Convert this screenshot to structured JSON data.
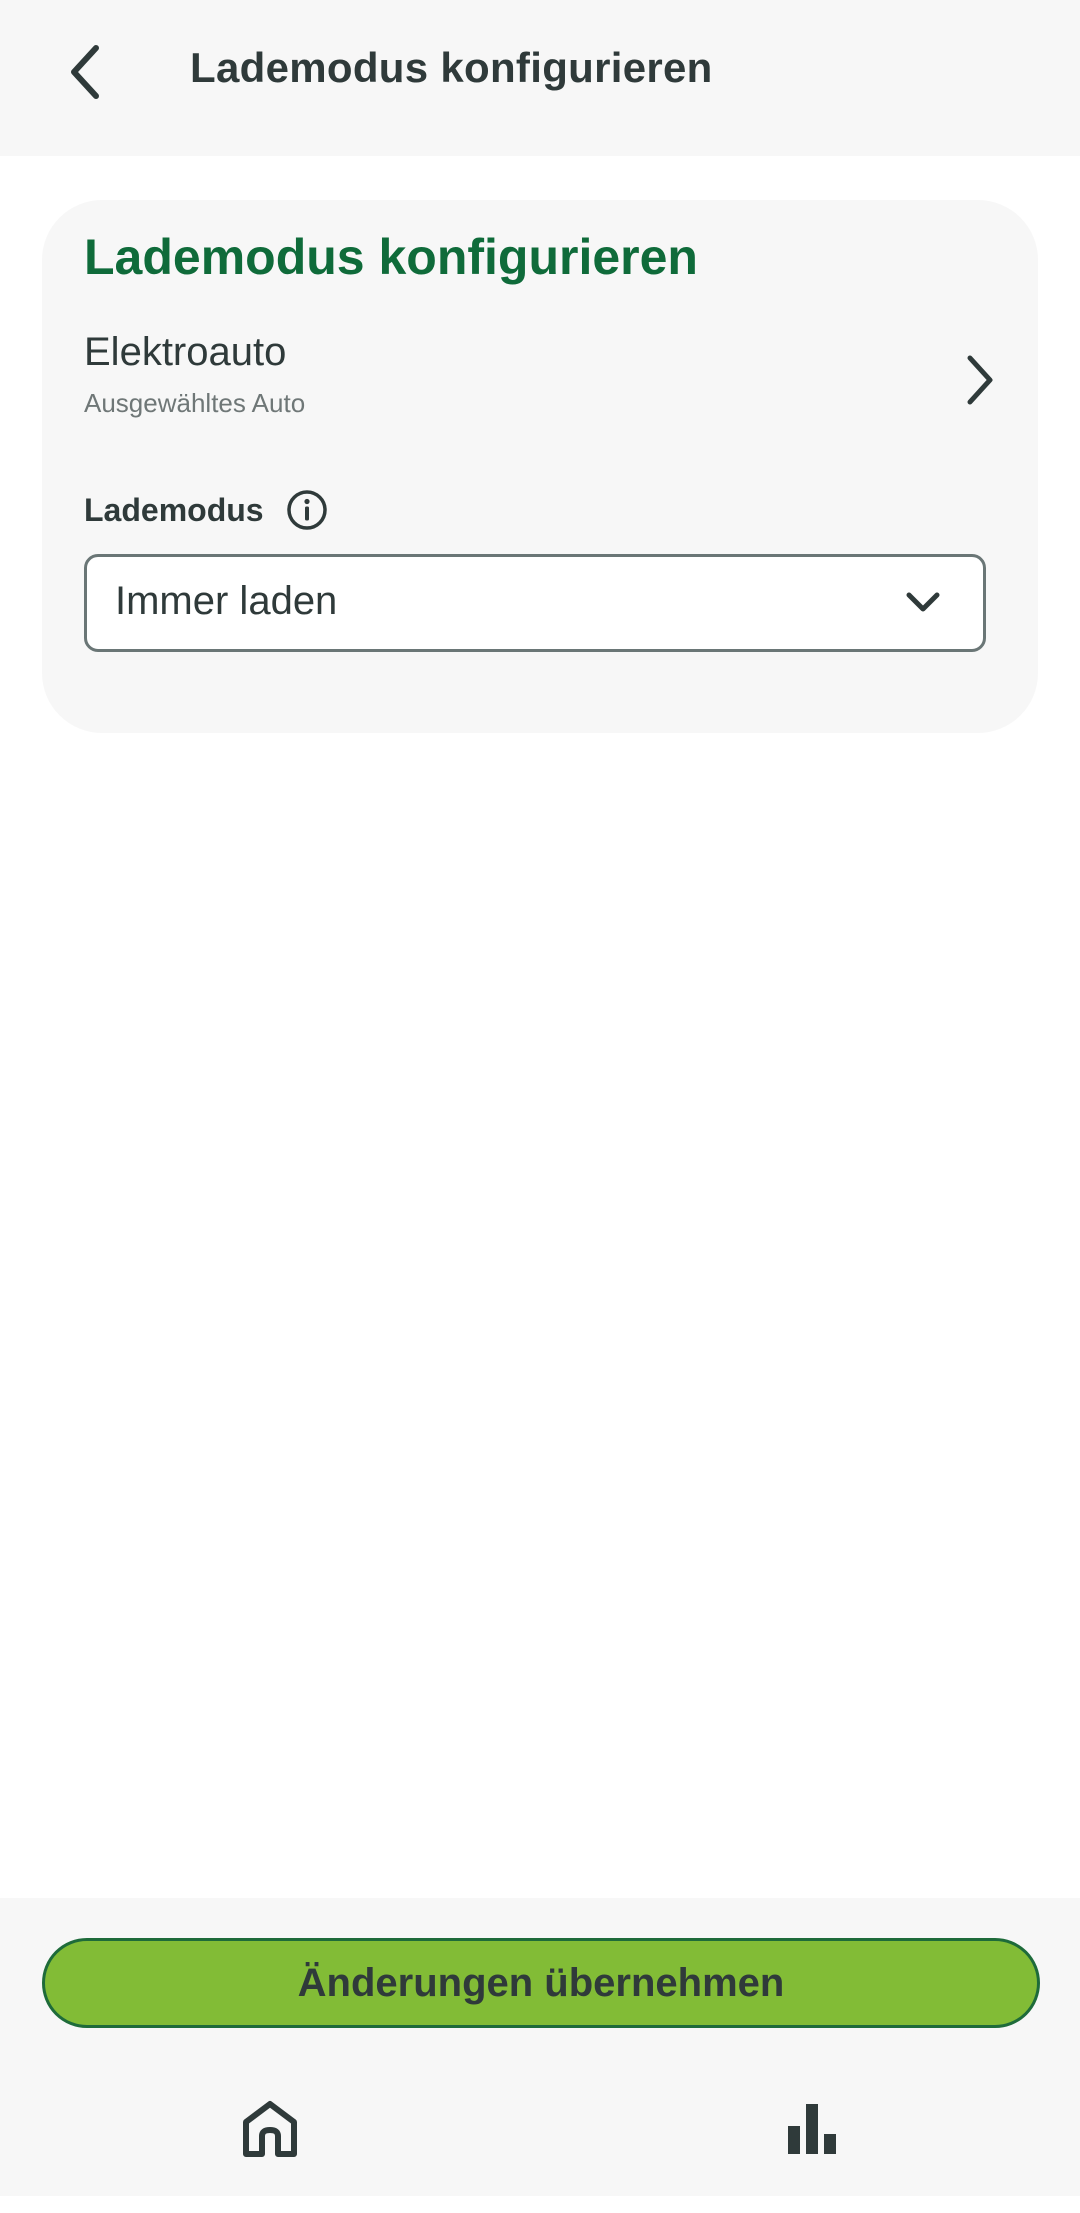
{
  "header": {
    "title": "Lademodus konfigurieren",
    "back_icon": "chevron-left-icon"
  },
  "card": {
    "title": "Lademodus konfigurieren",
    "car": {
      "name": "Elektroauto",
      "subtitle": "Ausgewähltes Auto",
      "icon": "chevron-right-icon"
    },
    "mode": {
      "label": "Lademodus",
      "info_icon": "info-icon",
      "selected_value": "Immer laden",
      "dropdown_icon": "chevron-down-icon"
    }
  },
  "footer": {
    "apply_label": "Änderungen übernehmen",
    "nav": [
      {
        "icon": "home-icon"
      },
      {
        "icon": "bar-chart-icon"
      }
    ]
  },
  "colors": {
    "accent_green": "#82bc36",
    "title_green": "#0f6b3a",
    "text_dark": "#2f3a3a",
    "surface": "#f7f7f7"
  }
}
